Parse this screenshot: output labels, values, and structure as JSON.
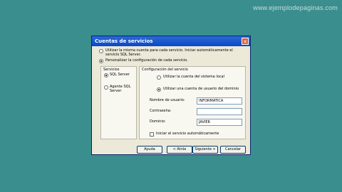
{
  "watermark": "www.ejemplodepaginas.com",
  "dialog": {
    "title": "Cuentas de servicios",
    "close_glyph": "✕",
    "option_same_account": "Utilizar la misma cuenta para cada servicio. Iniciar automáticamente el servicio SQL Server.",
    "option_custom": "Personalizar la configuración de cada servicio.",
    "services": {
      "label": "Servicios",
      "items": [
        "SQL Server",
        "Agente SQL Server"
      ],
      "selected": "SQL Server"
    },
    "config": {
      "label": "Configuración del servicio",
      "opt_local_system": "Utilizar la cuenta del sistema local",
      "opt_domain_user": "Utilizar una cuenta de usuario del dominio",
      "username_label": "Nombre de usuario:",
      "username_value": "INFORMATICA",
      "password_label": "Contraseña:",
      "password_value": "",
      "domain_label": "Dominio:",
      "domain_value": "JAVIER",
      "autostart_label": "Iniciar el servicio automáticamente"
    },
    "buttons": {
      "help": "Ayuda",
      "back": "< Atrás",
      "next": "Siguiente >",
      "cancel": "Cancelar"
    }
  }
}
